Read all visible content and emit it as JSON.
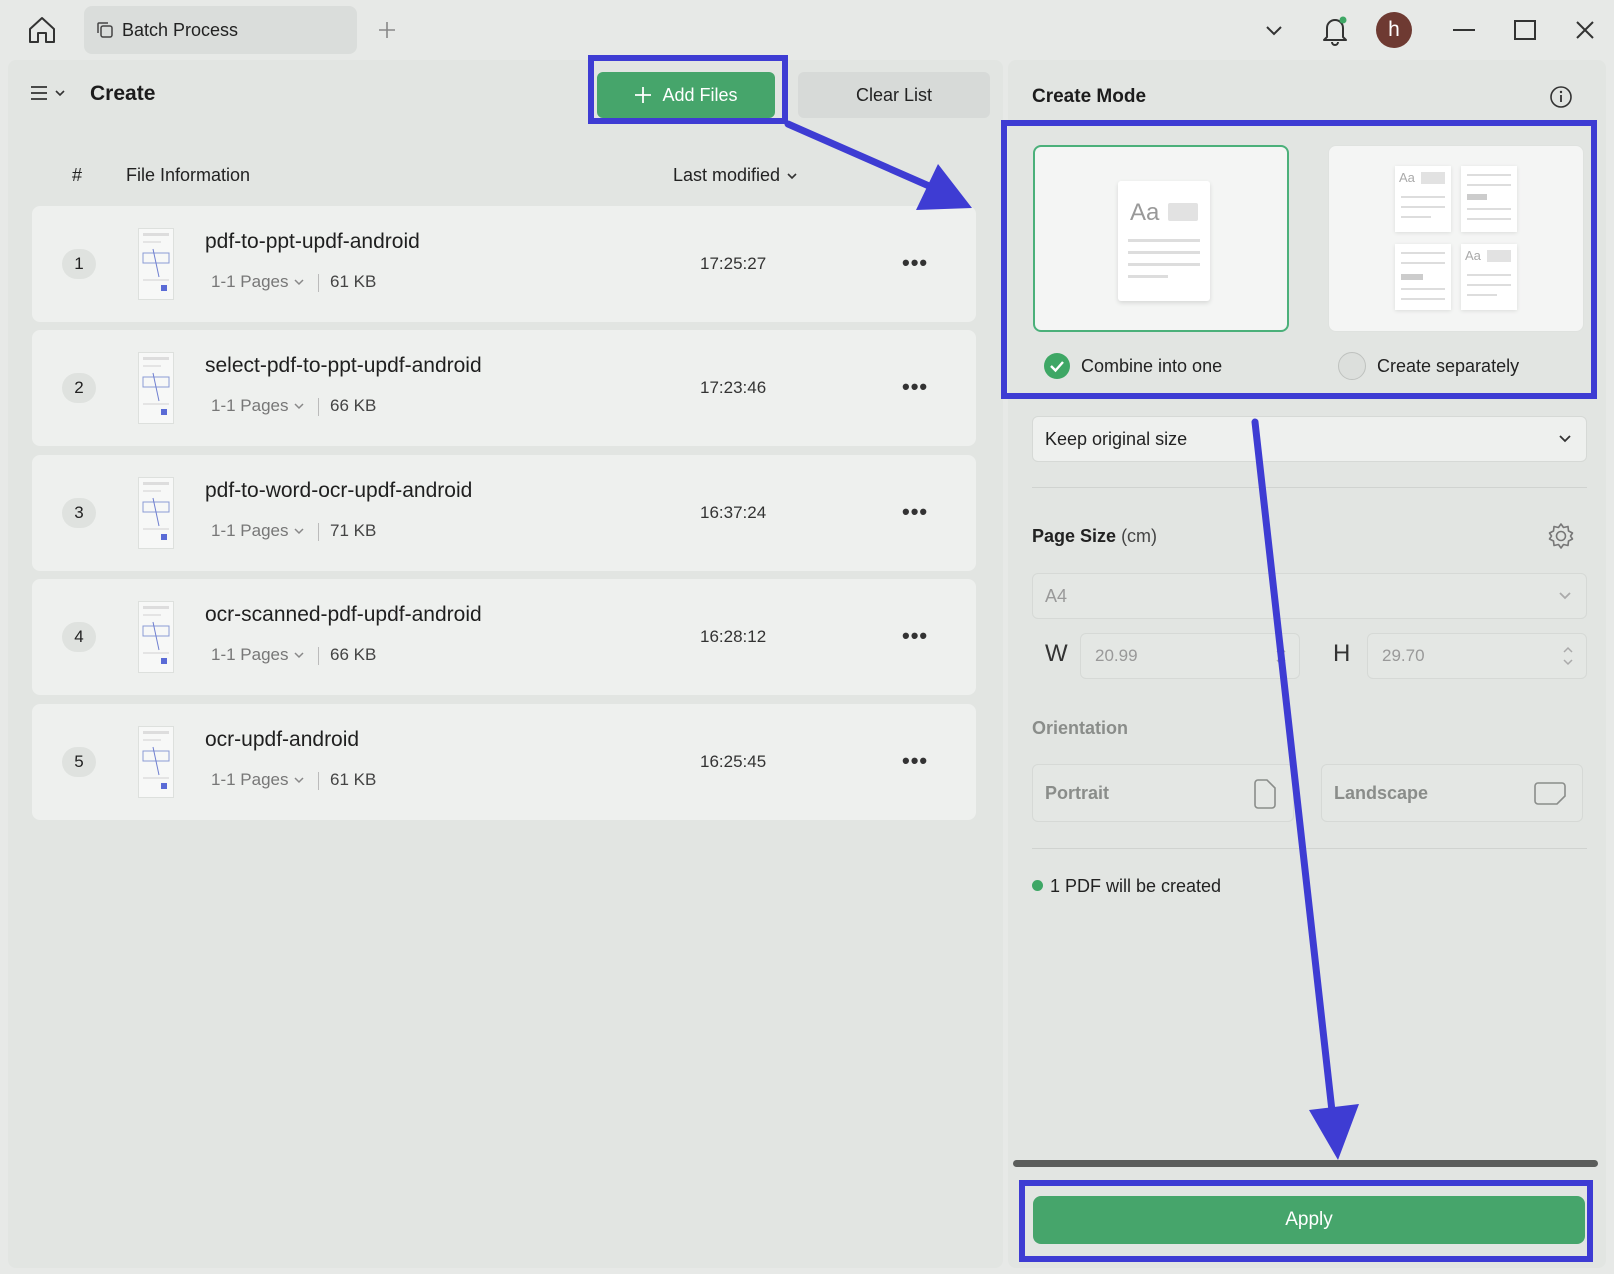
{
  "titlebar": {
    "tab_label": "Batch Process",
    "avatar_initial": "h",
    "icons": [
      "home-icon",
      "batch-process-icon",
      "new-tab-plus-icon",
      "chevron-down-icon",
      "bell-icon",
      "minimize-icon",
      "maximize-icon",
      "close-icon"
    ]
  },
  "left": {
    "title": "Create",
    "add_files_label": "Add Files",
    "clear_list_label": "Clear List",
    "columns": {
      "index": "#",
      "file_info": "File Information",
      "last_modified": "Last modified"
    },
    "files": [
      {
        "index": "1",
        "name": "pdf-to-ppt-updf-android",
        "pages": "1-1 Pages",
        "size": "61 KB",
        "time": "17:25:27"
      },
      {
        "index": "2",
        "name": "select-pdf-to-ppt-updf-android",
        "pages": "1-1 Pages",
        "size": "66 KB",
        "time": "17:23:46"
      },
      {
        "index": "3",
        "name": "pdf-to-word-ocr-updf-android",
        "pages": "1-1 Pages",
        "size": "71 KB",
        "time": "16:37:24"
      },
      {
        "index": "4",
        "name": "ocr-scanned-pdf-updf-android",
        "pages": "1-1 Pages",
        "size": "66 KB",
        "time": "16:28:12"
      },
      {
        "index": "5",
        "name": "ocr-updf-android",
        "pages": "1-1 Pages",
        "size": "61 KB",
        "time": "16:25:45"
      }
    ],
    "more_glyph": "•••"
  },
  "right": {
    "mode_title": "Create Mode",
    "combine_label": "Combine into one",
    "separate_label": "Create separately",
    "card_text": "Aa",
    "size_option": "Keep original size",
    "page_size_label": "Page Size",
    "page_size_unit": "(cm)",
    "paper": "A4",
    "w_label": "W",
    "w_value": "20.99",
    "h_label": "H",
    "h_value": "29.70",
    "orientation_label": "Orientation",
    "portrait_label": "Portrait",
    "landscape_label": "Landscape",
    "count_text": "1 PDF will be created",
    "apply_label": "Apply"
  },
  "colors": {
    "accent_green": "#46a56b",
    "annotation_blue": "#3e3cd3"
  }
}
